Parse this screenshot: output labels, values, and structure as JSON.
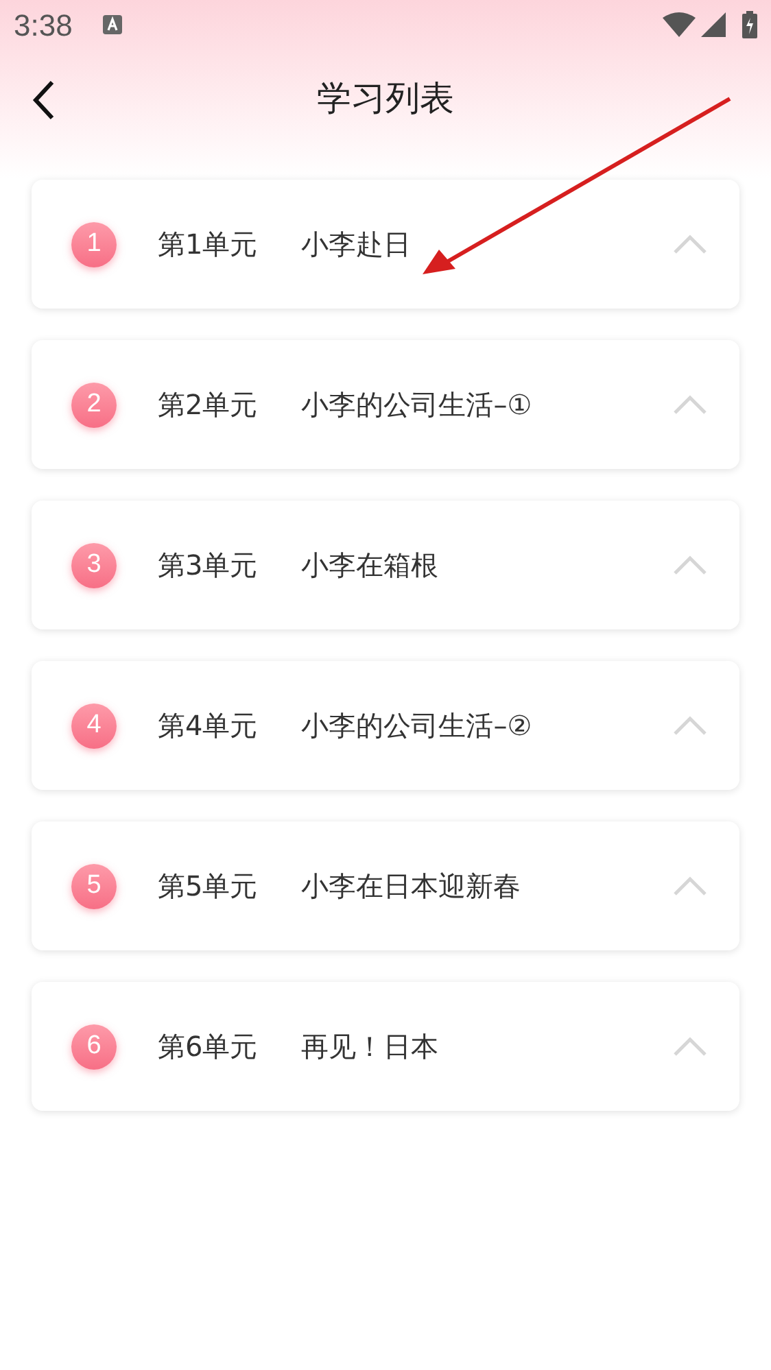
{
  "status_bar": {
    "time": "3:38"
  },
  "header": {
    "title": "学习列表"
  },
  "units": [
    {
      "number": "1",
      "unit": "第1单元",
      "title": "小李赴日"
    },
    {
      "number": "2",
      "unit": "第2单元",
      "title": "小李的公司生活–①"
    },
    {
      "number": "3",
      "unit": "第3单元",
      "title": "小李在箱根"
    },
    {
      "number": "4",
      "unit": "第4单元",
      "title": "小李的公司生活–②"
    },
    {
      "number": "5",
      "unit": "第5单元",
      "title": "小李在日本迎新春"
    },
    {
      "number": "6",
      "unit": "第6单元",
      "title": "再见！日本"
    }
  ]
}
